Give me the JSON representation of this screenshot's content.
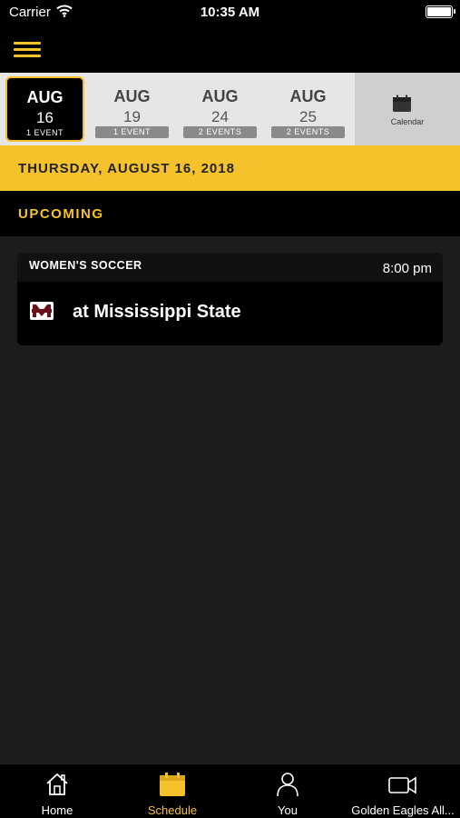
{
  "status_bar": {
    "carrier": "Carrier",
    "time": "10:35 AM",
    "wifi_icon": "wifi-icon",
    "battery_icon": "battery-icon"
  },
  "nav": {
    "menu_icon": "hamburger-menu-icon"
  },
  "date_strip": {
    "items": [
      {
        "month": "AUG",
        "day": "16",
        "events": "1 EVENT",
        "selected": true
      },
      {
        "month": "AUG",
        "day": "19",
        "events": "1 EVENT",
        "selected": false
      },
      {
        "month": "AUG",
        "day": "24",
        "events": "2 EVENTS",
        "selected": false
      },
      {
        "month": "AUG",
        "day": "25",
        "events": "2 EVENTS",
        "selected": false
      }
    ],
    "calendar_label": "Calendar",
    "calendar_icon": "calendar-icon"
  },
  "date_header": "THURSDAY, AUGUST 16, 2018",
  "section_label": "UPCOMING",
  "events": [
    {
      "sport": "WOMEN'S SOCCER",
      "time": "8:00 pm",
      "opponent": "at Mississippi State",
      "logo": "mississippi-state-logo"
    }
  ],
  "tabs": [
    {
      "label": "Home",
      "icon": "home-icon",
      "active": false
    },
    {
      "label": "Schedule",
      "icon": "schedule-calendar-icon",
      "active": true
    },
    {
      "label": "You",
      "icon": "person-icon",
      "active": false
    },
    {
      "label": "Golden Eagles All...",
      "icon": "video-camera-icon",
      "active": false
    }
  ],
  "colors": {
    "accent": "#f5c22c",
    "background": "#1c1c1c",
    "strip": "#e6e6e6"
  }
}
